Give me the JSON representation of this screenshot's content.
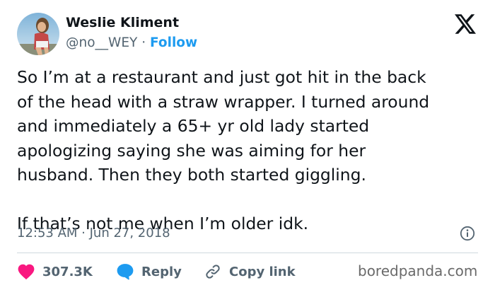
{
  "author": {
    "display_name": "Weslie Kliment",
    "handle": "@no__WEY",
    "separator": "·",
    "follow_label": "Follow",
    "avatar_icon": "profile-photo"
  },
  "platform": {
    "logo_icon": "x-logo"
  },
  "tweet": {
    "lines": [
      "So I’m at a restaurant and just got hit in the back",
      "of the head with a straw wrapper. I turned around",
      "and immediately a 65+ yr old lady started",
      "apologizing saying she was aiming for her",
      "husband. Then they both started giggling.",
      "",
      "If that’s not me when I’m older idk."
    ],
    "timestamp": "12:53 AM · Jun 27, 2018"
  },
  "actions": {
    "like_count": "307.3K",
    "reply_label": "Reply",
    "copy_link_label": "Copy link"
  },
  "watermark": "boredpanda.com",
  "colors": {
    "text": "#0f1419",
    "secondary": "#536471",
    "link_blue": "#1d9bf0",
    "heart_red": "#f91880",
    "divider": "#cfd9de"
  }
}
